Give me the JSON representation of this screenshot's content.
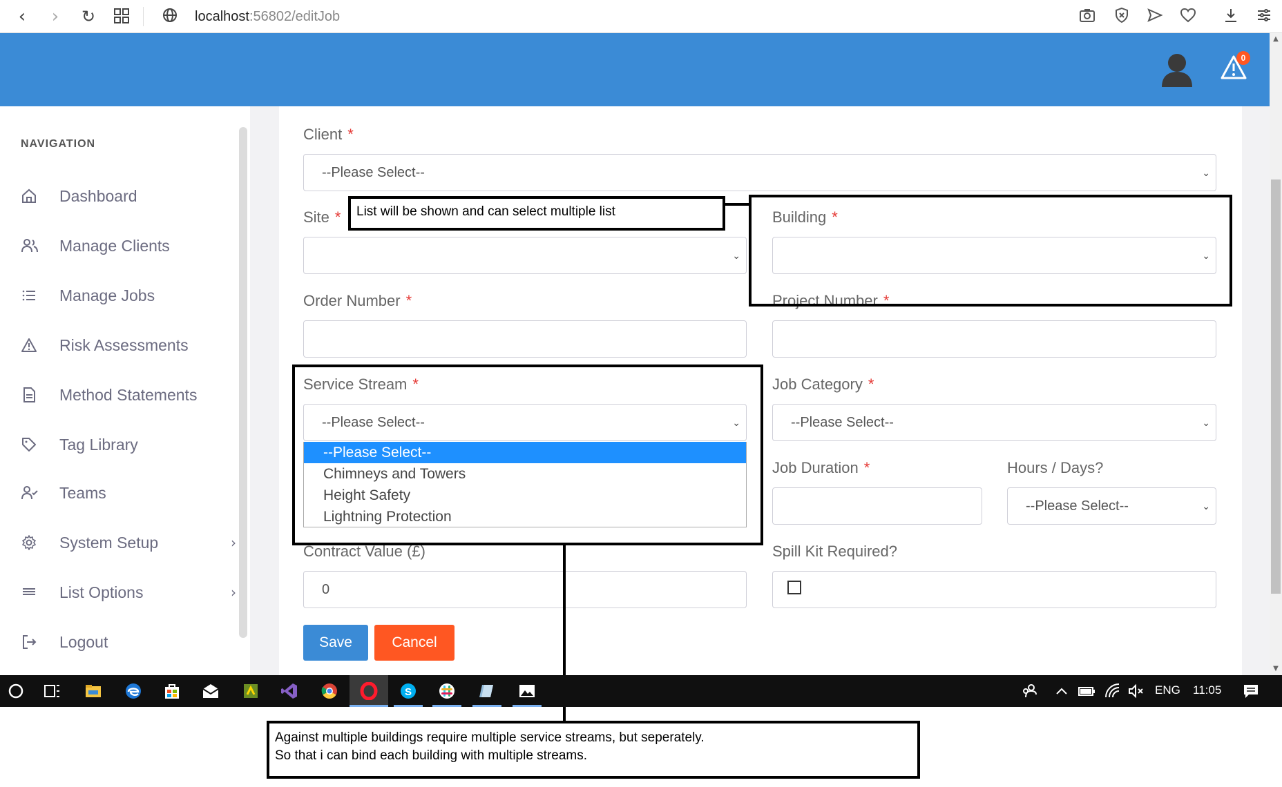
{
  "browser": {
    "url_host": "localhost",
    "url_rest": ":56802/editJob"
  },
  "header": {
    "alert_count": "0"
  },
  "sidebar": {
    "heading": "NAVIGATION",
    "items": [
      {
        "label": "Dashboard",
        "icon": "home-icon"
      },
      {
        "label": "Manage Clients",
        "icon": "users-icon"
      },
      {
        "label": "Manage Jobs",
        "icon": "list-icon"
      },
      {
        "label": "Risk Assessments",
        "icon": "warning-icon"
      },
      {
        "label": "Method Statements",
        "icon": "document-icon"
      },
      {
        "label": "Tag Library",
        "icon": "tag-icon"
      },
      {
        "label": "Teams",
        "icon": "user-check-icon"
      },
      {
        "label": "System Setup",
        "icon": "gear-icon"
      },
      {
        "label": "List Options",
        "icon": "menu-icon"
      },
      {
        "label": "Logout",
        "icon": "logout-icon"
      }
    ]
  },
  "form": {
    "client_label": "Client",
    "client_value": "--Please Select--",
    "site_label": "Site",
    "site_value": "",
    "building_label": "Building",
    "building_value": "",
    "order_number_label": "Order Number",
    "order_number_value": "",
    "project_number_label": "Project Number",
    "project_number_value": "",
    "service_stream_label": "Service Stream",
    "service_stream_value": "--Please Select--",
    "service_stream_options": [
      "--Please Select--",
      "Chimneys and Towers",
      "Height Safety",
      "Lightning Protection"
    ],
    "job_category_label": "Job Category",
    "job_category_value": "--Please Select--",
    "job_duration_label": "Job Duration",
    "job_duration_value": "",
    "hours_days_label": "Hours / Days?",
    "hours_days_value": "--Please Select--",
    "contract_value_label": "Contract Value (£)",
    "contract_value_value": "0",
    "spill_kit_label": "Spill Kit Required?",
    "required_mark": "*",
    "save_label": "Save",
    "cancel_label": "Cancel"
  },
  "annotations": {
    "site_note": "List will be shown and can select multiple list",
    "bottom_note_line1": "Against multiple buildings require multiple service streams, but seperately.",
    "bottom_note_line2": "So that i can bind each building with multiple streams."
  },
  "taskbar": {
    "language": "ENG",
    "time": "11:05"
  },
  "colors": {
    "header_blue": "#3b8bd6",
    "cancel_orange": "#ff5722",
    "required_red": "#e53935",
    "selected_option": "#1e90ff"
  }
}
